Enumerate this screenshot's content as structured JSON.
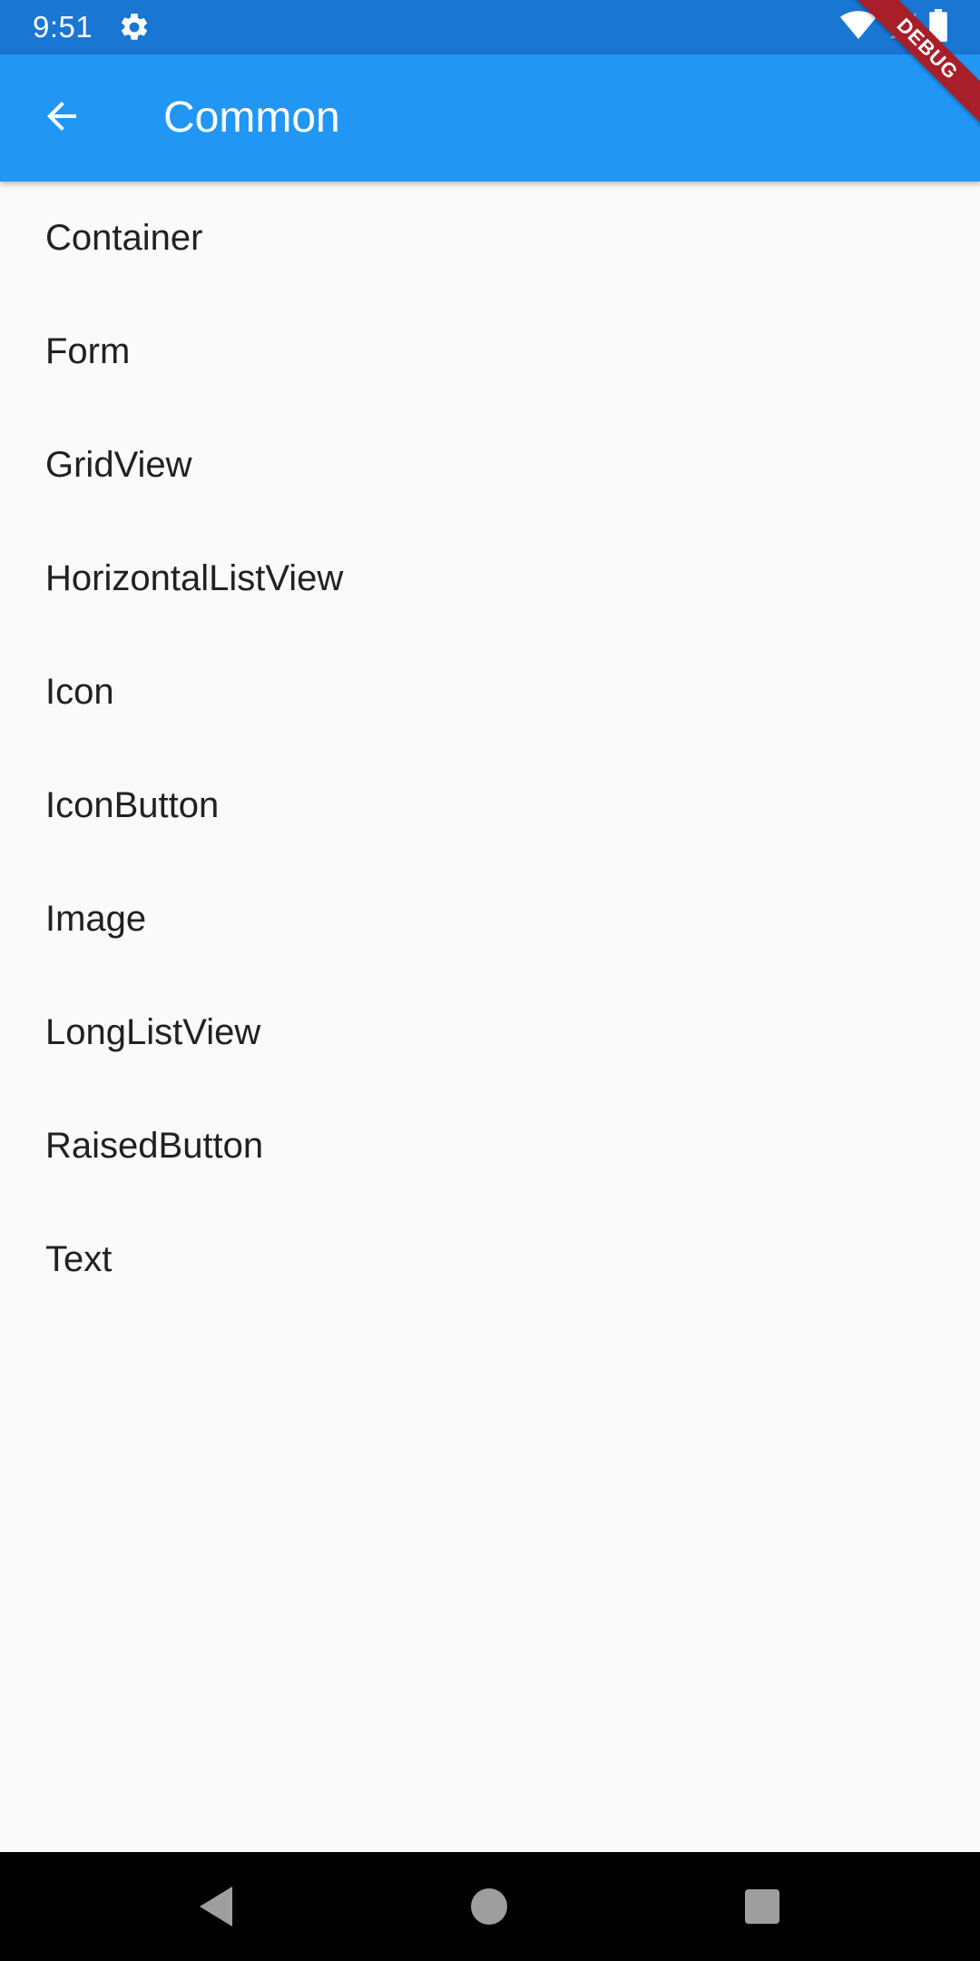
{
  "status_bar": {
    "time": "9:51",
    "color": "#1976d2",
    "icons": [
      "gear-icon",
      "wifi-icon",
      "signal-icon",
      "battery-icon"
    ]
  },
  "app_bar": {
    "title": "Common",
    "color": "#2196f3",
    "back_icon": "arrow-back-icon"
  },
  "debug_banner": {
    "label": "DEBUG",
    "color": "#a81f2a"
  },
  "list": {
    "items": [
      {
        "label": "Container"
      },
      {
        "label": "Form"
      },
      {
        "label": "GridView"
      },
      {
        "label": "HorizontalListView"
      },
      {
        "label": "Icon"
      },
      {
        "label": "IconButton"
      },
      {
        "label": "Image"
      },
      {
        "label": "LongListView"
      },
      {
        "label": "RaisedButton"
      },
      {
        "label": "Text"
      }
    ]
  },
  "nav_bar": {
    "buttons": [
      "back-nav-icon",
      "home-nav-icon",
      "recents-nav-icon"
    ]
  }
}
